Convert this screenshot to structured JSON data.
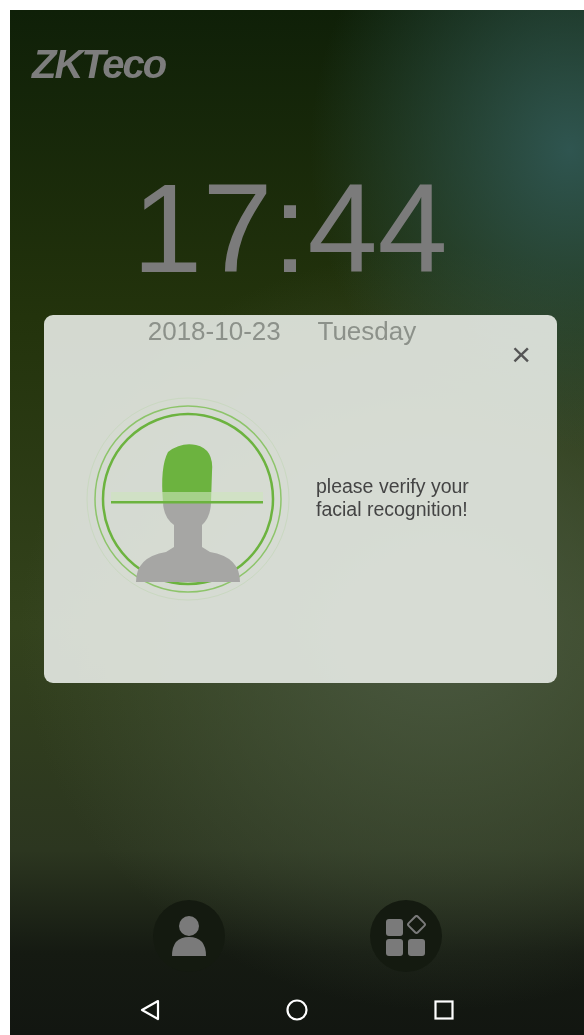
{
  "brand": {
    "logo": "ZKTeco"
  },
  "clock": {
    "time": "17:44",
    "date": "2018-10-23",
    "weekday": "Tuesday"
  },
  "dialog": {
    "close": "×",
    "message": "please verify your facial recognition!"
  },
  "dock": [
    {
      "kind": "user"
    },
    {
      "kind": "apps"
    }
  ],
  "nav_bar": [
    {
      "kind": "back"
    },
    {
      "kind": "home"
    },
    {
      "kind": "recents"
    }
  ]
}
